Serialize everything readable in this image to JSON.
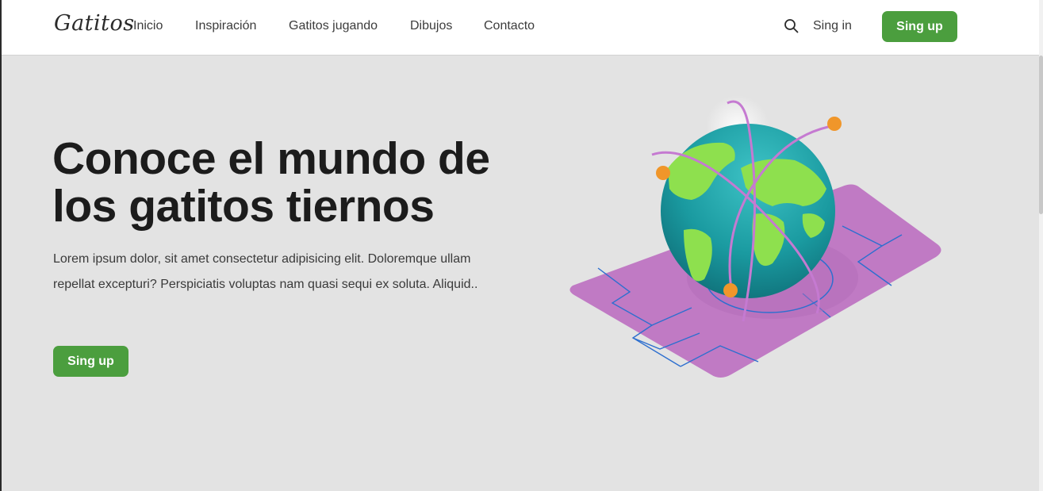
{
  "header": {
    "brand": "Gatitos",
    "nav": [
      {
        "label": "Inicio"
      },
      {
        "label": "Inspiración"
      },
      {
        "label": "Gatitos jugando"
      },
      {
        "label": "Dibujos"
      },
      {
        "label": "Contacto"
      }
    ],
    "search_icon": "search-icon",
    "signin_label": "Sing in",
    "signup_label": "Sing up"
  },
  "hero": {
    "title_line1": "Conoce el mundo de",
    "title_line2": "los gatitos tiernos",
    "text": "Lorem ipsum dolor, sit amet consectetur adipisicing elit. Doloremque ullam repellat excepturi? Perspiciatis voluptas nam quasi sequi ex soluta. Aliquid..",
    "cta_label": "Sing up"
  },
  "colors": {
    "accent_green": "#4b9e3e",
    "background": "#e3e3e3",
    "platform_purple": "#c07ac4",
    "globe_teal": "#1e9ba0",
    "land_green": "#8ee04e",
    "orbit_dot": "#f0962a"
  }
}
